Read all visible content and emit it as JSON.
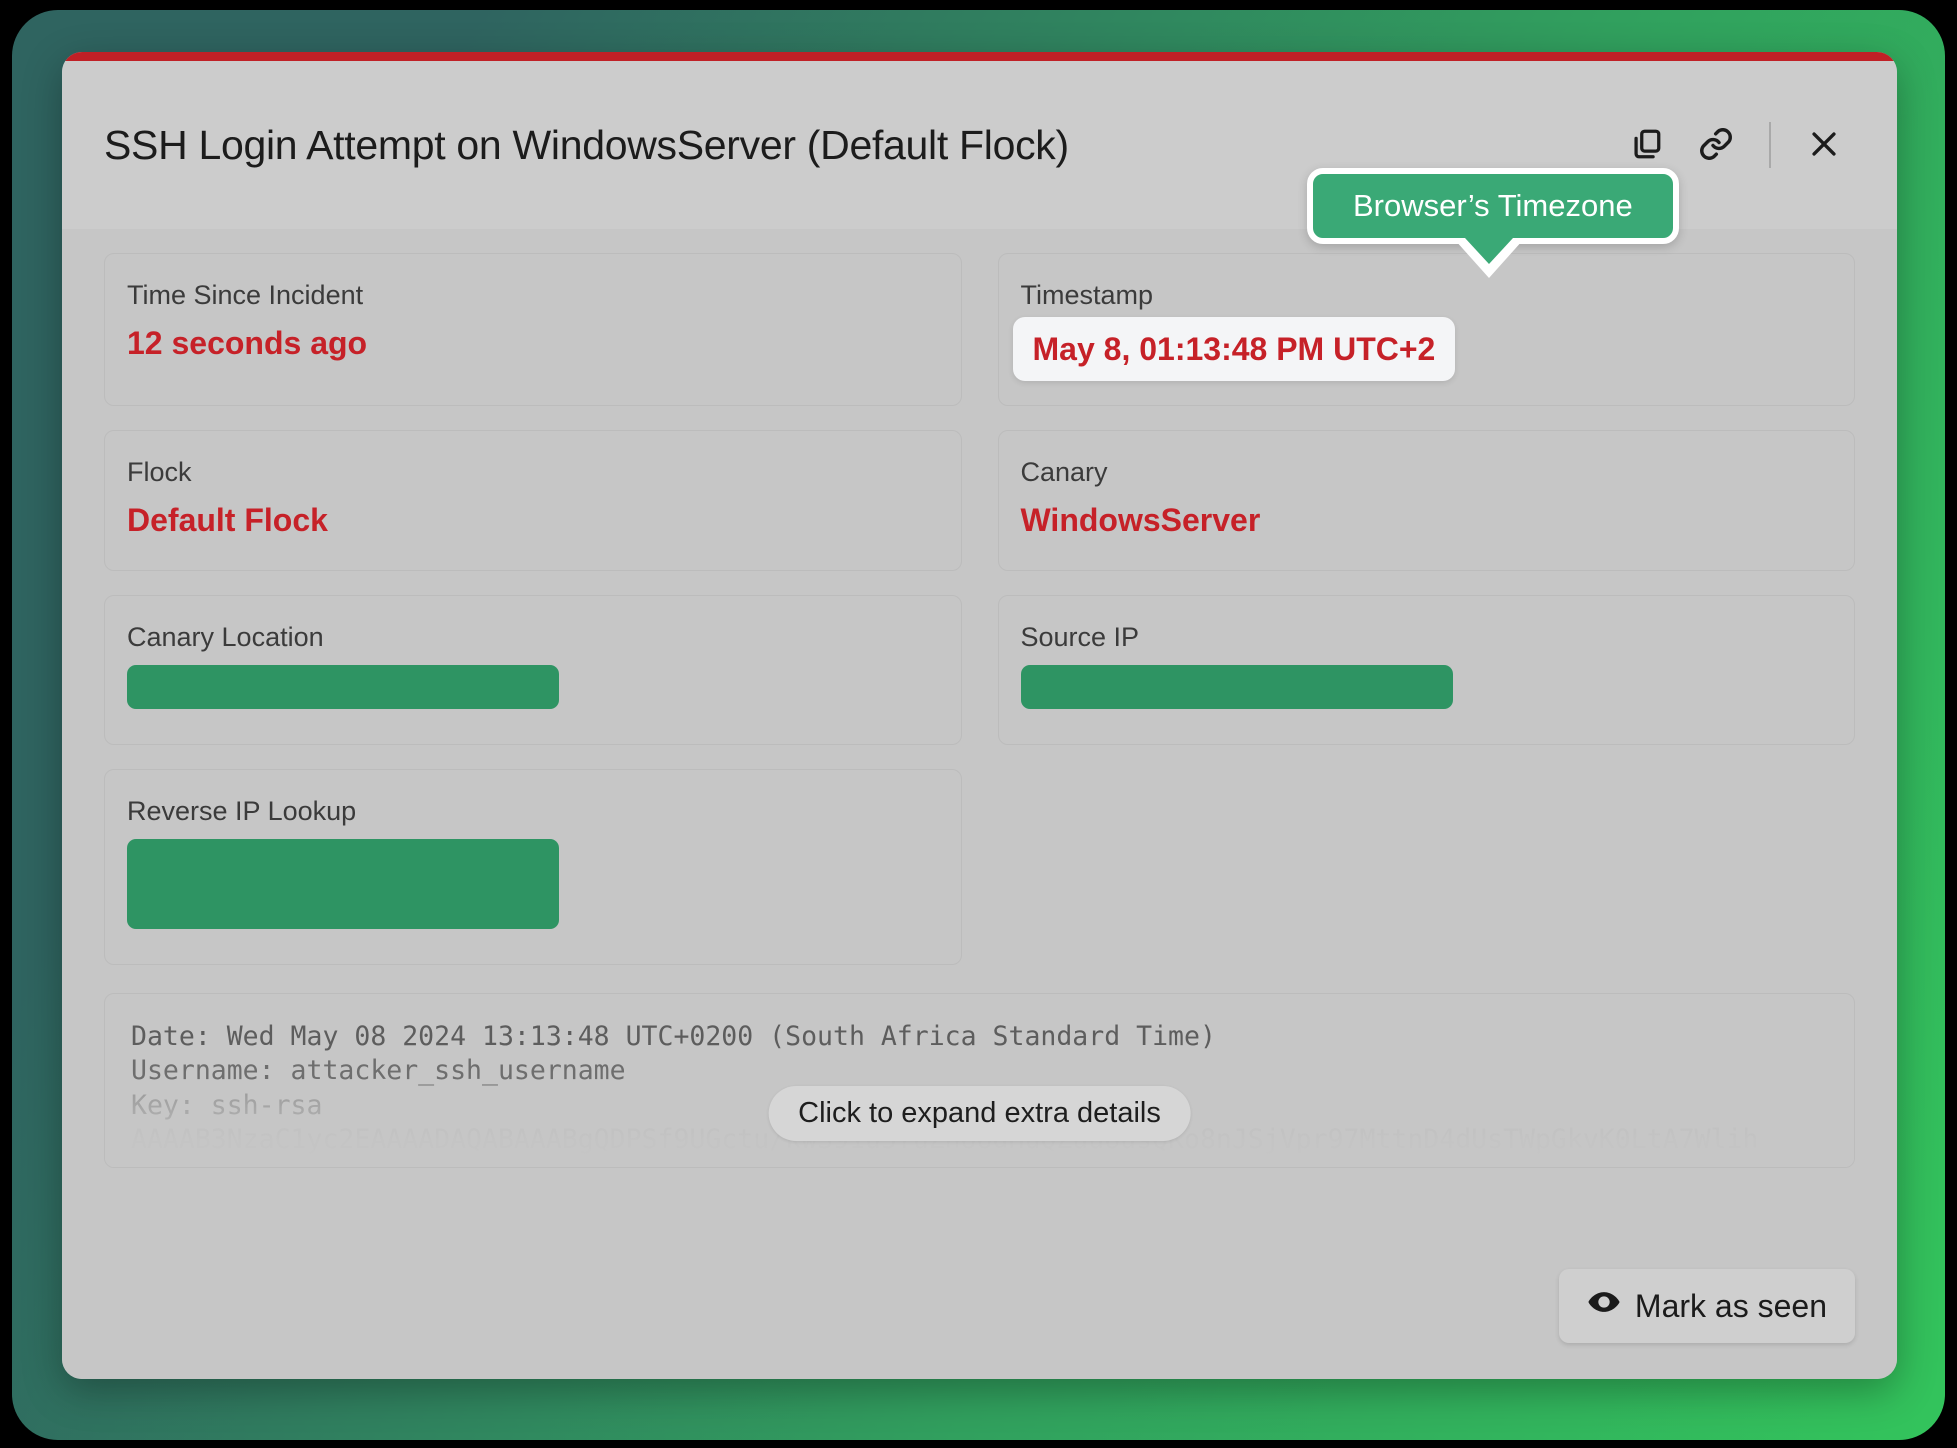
{
  "window": {
    "title": "SSH Login Attempt on WindowsServer (Default Flock)",
    "accent_color": "#c02026",
    "brand_green": "#2e9463",
    "alert_red": "#c62128"
  },
  "header": {
    "copy_icon": "copy-icon",
    "link_icon": "link-icon",
    "close_icon": "close-icon"
  },
  "tooltip": {
    "text": "Browser’s Timezone"
  },
  "fields": {
    "time_since_incident": {
      "label": "Time Since Incident",
      "value": "12 seconds ago"
    },
    "timestamp": {
      "label": "Timestamp",
      "value": "May 8, 01:13:48 PM UTC+2"
    },
    "flock": {
      "label": "Flock",
      "value": "Default Flock"
    },
    "canary": {
      "label": "Canary",
      "value": "WindowsServer"
    },
    "canary_location": {
      "label": "Canary Location",
      "value": "",
      "redacted": true
    },
    "source_ip": {
      "label": "Source IP",
      "value": "",
      "redacted": true
    },
    "reverse_ip_lookup": {
      "label": "Reverse IP Lookup",
      "value": "",
      "redacted": true
    }
  },
  "details": {
    "line1": "Date: Wed May 08 2024 13:13:48 UTC+0200 (South Africa Standard Time)",
    "line2": "Username: attacker_ssh_username",
    "line3": "Key: ssh-rsa",
    "line4": "AAAAB3NzaC1yc2EAAAADAQABAAABgQDPSf9UGctu/kwS91u3fuZhUUdHuQZuuUusQKo8nJSjVpr97MttnD4dUsTWpGkvK0LtA7Wlih",
    "expand_hint": "Click to expand extra details"
  },
  "footer": {
    "mark_as_seen_label": "Mark as seen",
    "eye_icon": "eye-icon"
  }
}
